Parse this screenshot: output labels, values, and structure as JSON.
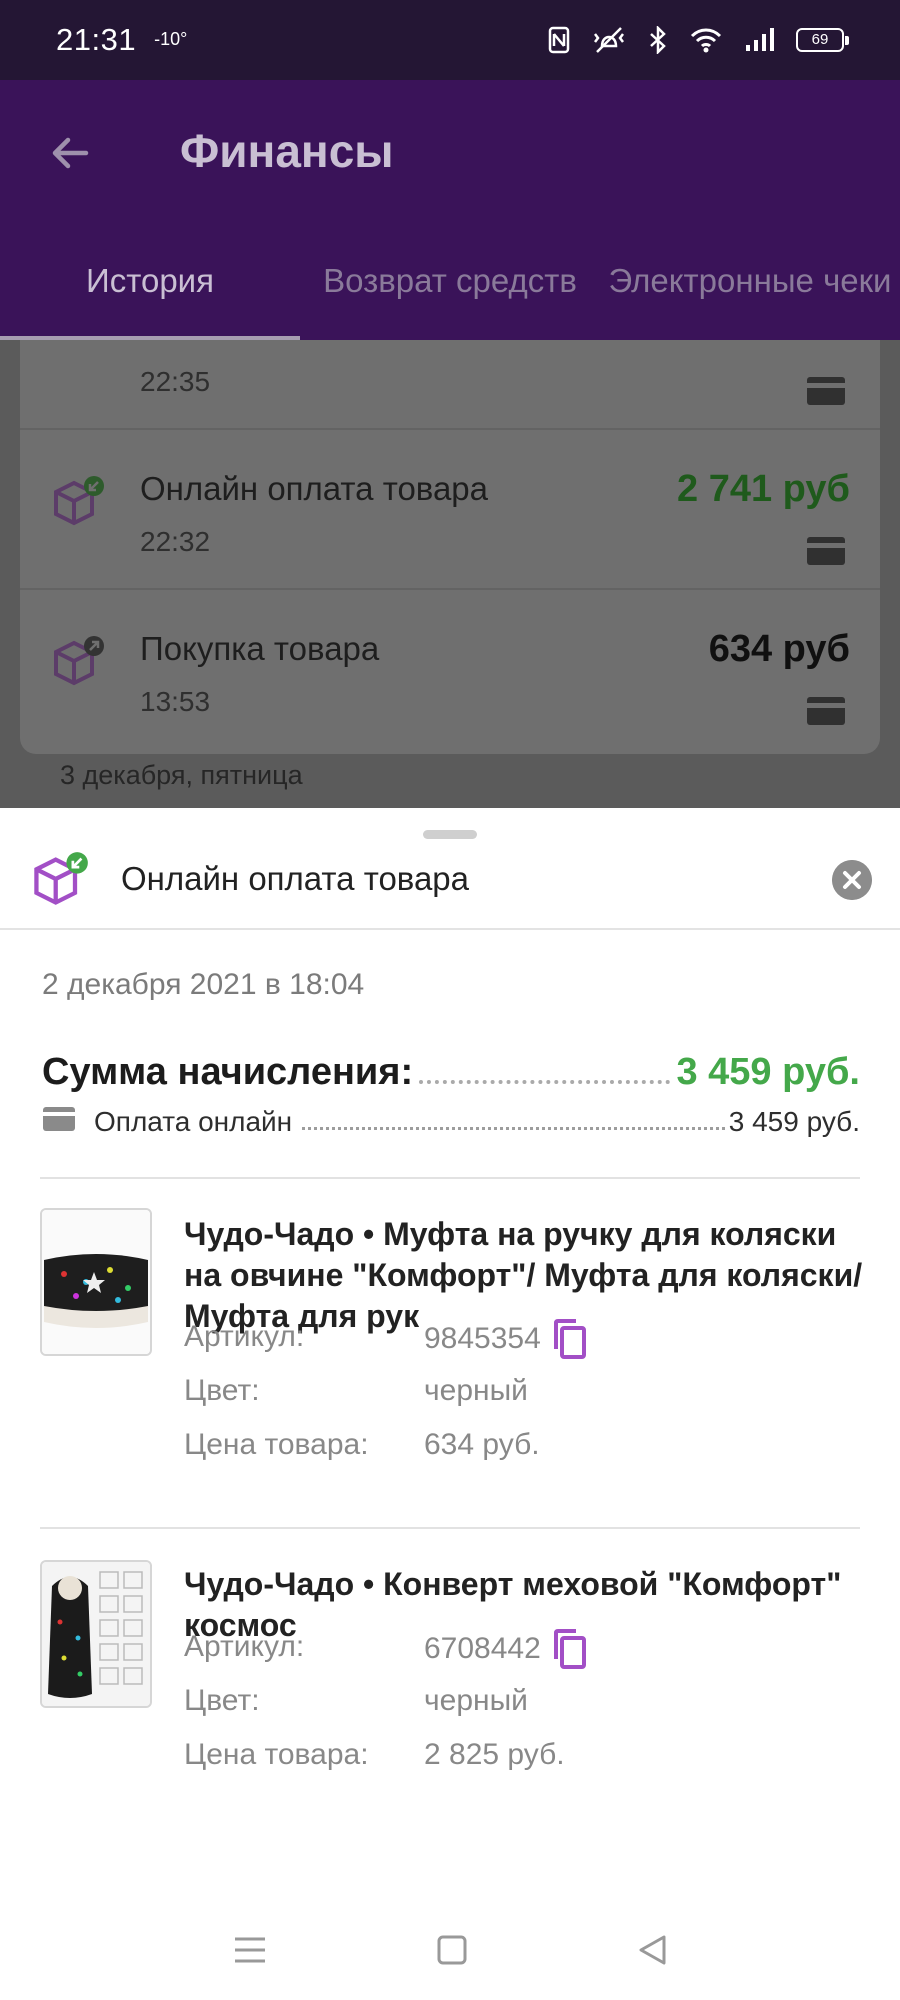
{
  "status_bar": {
    "time": "21:31",
    "temperature": "-10°",
    "battery": "69",
    "icons": [
      "nfc-icon",
      "vibrate-icon",
      "bluetooth-icon",
      "wifi-icon",
      "signal-icon",
      "battery-icon"
    ]
  },
  "app_bar": {
    "title": "Финансы",
    "tabs": [
      {
        "label": "История",
        "active": true
      },
      {
        "label": "Возврат средств",
        "active": false
      },
      {
        "label": "Электронные чеки",
        "active": false
      }
    ]
  },
  "history": {
    "partial_time": "22:35",
    "rows": [
      {
        "label": "Онлайн оплата товара",
        "time": "22:32",
        "amount": "2 741 руб",
        "amount_color": "#44a84a"
      },
      {
        "label": "Покупка товара",
        "time": "13:53",
        "amount": "634 руб",
        "amount_color": "#101010"
      }
    ],
    "next_date_header": "3 декабря, пятница"
  },
  "sheet": {
    "title": "Онлайн оплата товара",
    "date": "2 декабря 2021 в 18:04",
    "sum_label": "Сумма начисления:",
    "sum_value": "3 459 руб.",
    "payment_label": "Оплата онлайн",
    "payment_value": "3 459 руб.",
    "items": [
      {
        "name": "Чудо-Чадо • Муфта на ручку для коляски на овчине \"Комфорт\"/ Муфта для коляски/ Муфта для рук",
        "article_label": "Артикул:",
        "article": "9845354",
        "color_label": "Цвет:",
        "color": "черный",
        "price_label": "Цена товара:",
        "price": "634 руб."
      },
      {
        "name": "Чудо-Чадо • Конверт меховой \"Комфорт\" космос",
        "article_label": "Артикул:",
        "article": "6708442",
        "color_label": "Цвет:",
        "color": "черный",
        "price_label": "Цена товара:",
        "price": "2 825 руб."
      }
    ]
  },
  "colors": {
    "primary": "#3a1359",
    "accent_green": "#44a84a",
    "icon_purple": "#a24fc6"
  }
}
